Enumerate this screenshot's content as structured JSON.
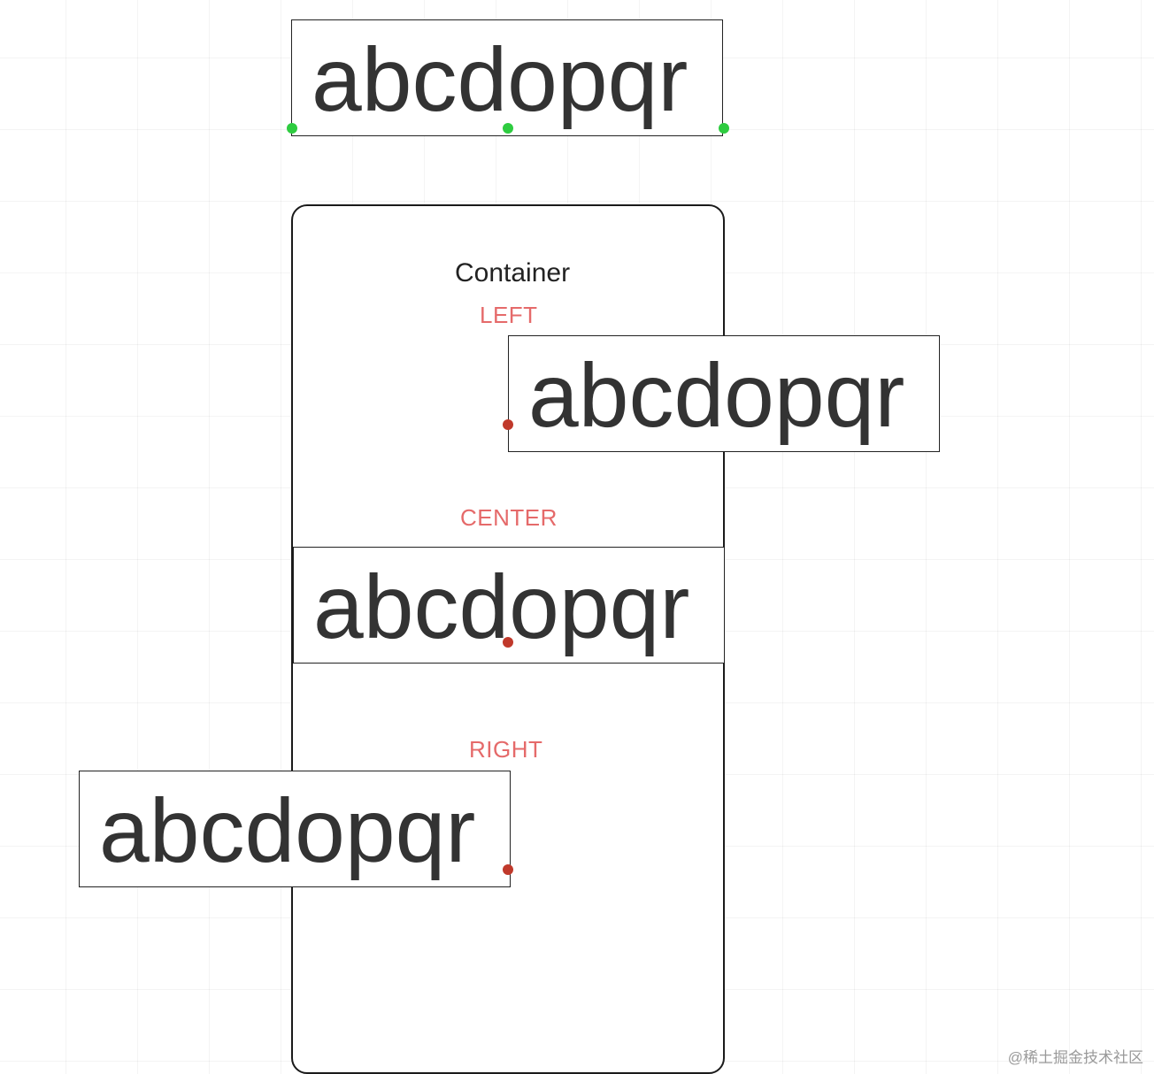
{
  "sample_text": "abcdopqr",
  "container": {
    "title": "Container",
    "labels": {
      "left": "LEFT",
      "center": "CENTER",
      "right": "RIGHT"
    }
  },
  "watermark": "@稀土掘金技术社区",
  "colors": {
    "green_dot": "#2ecc40",
    "red_dot": "#c0392b",
    "label": "#e56a6a",
    "border": "#222222"
  }
}
